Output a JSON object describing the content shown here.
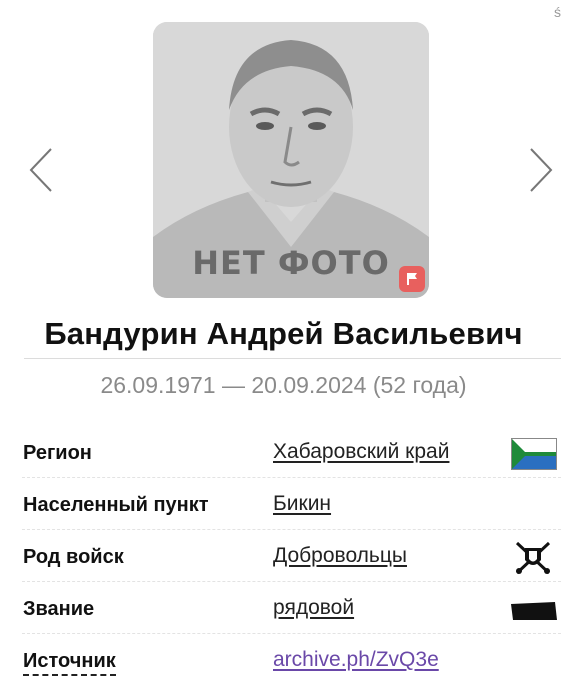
{
  "corner_mark": "ś",
  "photo": {
    "placeholder_text": "НЕТ ФОТО",
    "flag_icon": "flag-icon"
  },
  "nav": {
    "prev_icon": "chevron-left-icon",
    "next_icon": "chevron-right-icon"
  },
  "person": {
    "name": "Бандурин Андрей Васильевич",
    "dates": "26.09.1971 — 20.09.2024 (52 года)"
  },
  "info_rows": [
    {
      "label": "Регион",
      "value": "Хабаровский край",
      "icon": "khabarovsk-flag-icon"
    },
    {
      "label": "Населенный пункт",
      "value": "Бикин"
    },
    {
      "label": "Род войск",
      "value": "Добровольцы",
      "icon": "volunteers-emblem-icon"
    },
    {
      "label": "Звание",
      "value": "рядовой",
      "icon": "rank-insignia-icon"
    },
    {
      "label": "Источник",
      "value": "archive.ph/ZvQ3e",
      "value_color": "#6a48a8"
    }
  ]
}
